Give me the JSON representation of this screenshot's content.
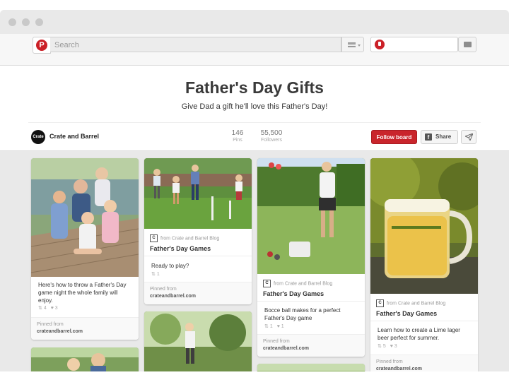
{
  "header": {
    "logo_letter": "P",
    "search_placeholder": "Search"
  },
  "board": {
    "title": "Father's Day Gifts",
    "description": "Give Dad a gift he'll love this Father's Day!",
    "owner": {
      "avatar_text": "Crate",
      "name": "Crate and Barrel"
    },
    "stats": [
      {
        "value": "146",
        "label": "Pins"
      },
      {
        "value": "55,500",
        "label": "Followers"
      }
    ],
    "follow_label": "Follow board",
    "share_label": "Share",
    "share_icon": "f"
  },
  "pins": [
    {
      "image": "family-on-dock-photo",
      "description": "Here's how to throw a Father's Day game night the whole family will enjoy.",
      "repins": "4",
      "likes": "3",
      "pinned_from_label": "Pinned from",
      "source": "crateandbarrel.com"
    },
    {
      "image": "lawn-games-photo",
      "from_text": "from Crate and Barrel Blog",
      "title": "Father's Day Games",
      "description": "Ready to play?",
      "repins": "1",
      "pinned_from_label": "Pinned from",
      "source": "crateandbarrel.com"
    },
    {
      "image": "bocce-ball-photo",
      "from_text": "from Crate and Barrel Blog",
      "title": "Father's Day Games",
      "description": "Bocce ball makes for a perfect Father's Day game",
      "repins": "1",
      "likes": "1",
      "pinned_from_label": "Pinned from",
      "source": "crateandbarrel.com"
    },
    {
      "image": "lime-lager-mug-photo",
      "from_text": "from Crate and Barrel Blog",
      "title": "Father's Day Games",
      "description": "Learn how to create a Lime lager beer perfect for summer.",
      "repins": "5",
      "likes": "3",
      "pinned_from_label": "Pinned from",
      "source": "crateandbarrel.com"
    }
  ],
  "colors": {
    "brand_red": "#c9252c",
    "page_background": "#e9e9e9"
  }
}
